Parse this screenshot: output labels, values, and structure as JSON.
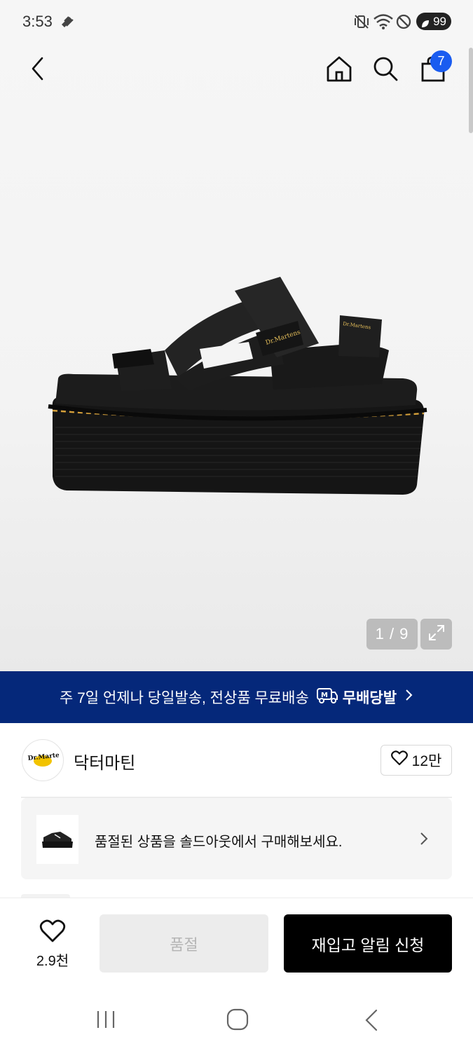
{
  "status_bar": {
    "time": "3:53",
    "battery": "99",
    "icons": [
      "vibrate-off-icon",
      "wifi-icon",
      "do-not-disturb-icon",
      "battery-icon"
    ]
  },
  "top_nav": {
    "back_icon": "chevron-left-icon",
    "home_icon": "home-icon",
    "search_icon": "search-icon",
    "cart_icon": "shopping-bag-icon",
    "cart_count": "7"
  },
  "gallery": {
    "counter": "1 / 9",
    "expand_icon": "expand-icon"
  },
  "promo": {
    "text": "주 7일 언제나 당일발송, 전상품 무료배송",
    "badge_label": "무배당발",
    "badge_icon": "delivery-truck-icon"
  },
  "brand": {
    "name": "닥터마틴",
    "logo_text": "Dr. Martens",
    "likes": "12만"
  },
  "soldout_card": {
    "text": "품절된 상품을 솔드아웃에서 구매해보세요."
  },
  "bottom_bar": {
    "wish_count": "2.9천",
    "soldout_label": "품절",
    "restock_label": "재입고 알림 신청"
  },
  "colors": {
    "promo_bg": "#05287a",
    "cart_badge": "#1a5cf0",
    "primary_button": "#000000",
    "disabled_button": "#ececec"
  }
}
